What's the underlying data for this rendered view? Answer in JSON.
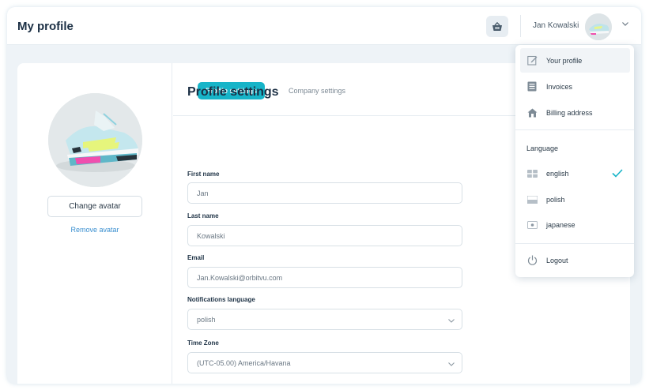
{
  "header": {
    "title": "My profile",
    "user_name": "Jan Kowalski",
    "cart_icon": "basket-icon"
  },
  "sidebar": {
    "change_avatar_label": "Change avatar",
    "remove_avatar_label": "Remove avatar"
  },
  "tabs": [
    {
      "label": "Profile settings",
      "active": true
    },
    {
      "label": "Company settings",
      "active": false
    }
  ],
  "form": {
    "title": "Profile settings",
    "fields": [
      {
        "label": "First name",
        "value": "Jan"
      },
      {
        "label": "Last name",
        "value": "Kowalski"
      },
      {
        "label": "Email",
        "value": "Jan.Kowalski@orbitvu.com"
      },
      {
        "label": "Notifications language",
        "value": "polish"
      },
      {
        "label": "Time Zone",
        "value": "(UTC-05.00) America/Havana"
      }
    ]
  },
  "dropdown": {
    "items": [
      {
        "label": "Your profile",
        "icon": "edit-icon"
      },
      {
        "label": "Invoices",
        "icon": "invoice-icon"
      },
      {
        "label": "Billing address",
        "icon": "home-icon"
      }
    ],
    "language_heading": "Language",
    "languages": [
      {
        "label": "english",
        "selected": true
      },
      {
        "label": "polish",
        "selected": false
      },
      {
        "label": "japanese",
        "selected": false
      }
    ],
    "logout_label": "Logout"
  },
  "colors": {
    "accent": "#17b4c8",
    "link": "#3a8fd0",
    "background": "#eef3f7"
  }
}
